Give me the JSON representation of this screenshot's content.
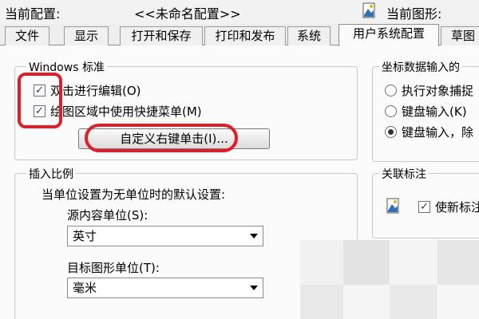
{
  "header": {
    "current_profile_label": "当前配置:",
    "current_profile_value": "<<未命名配置>>",
    "current_drawing_label": "当前图形:"
  },
  "tabs": [
    {
      "label": "文件"
    },
    {
      "label": "显示"
    },
    {
      "label": "打开和保存"
    },
    {
      "label": "打印和发布"
    },
    {
      "label": "系统"
    },
    {
      "label": "用户系统配置",
      "active": true
    },
    {
      "label": "草图"
    }
  ],
  "windows_standard": {
    "legend": "Windows 标准",
    "double_click_edit": {
      "label": "双击进行编辑(O)",
      "checked": true
    },
    "shortcut_menu": {
      "label": "绘图区域中使用快捷菜单(M)",
      "checked": true
    },
    "right_click_button": "自定义右键单击(I)..."
  },
  "insert_scale": {
    "legend": "插入比例",
    "description": "当单位设置为无单位时的默认设置:",
    "source_label": "源内容单位(S):",
    "source_value": "英寸",
    "target_label": "目标图形单位(T):",
    "target_value": "毫米"
  },
  "coord_input": {
    "legend": "坐标数据输入的",
    "options": [
      {
        "label": "执行对象捕捉",
        "selected": false
      },
      {
        "label": "键盘输入(K)",
        "selected": false
      },
      {
        "label": "键盘输入，除",
        "selected": true
      }
    ]
  },
  "associative_dim": {
    "legend": "关联标注",
    "checkbox_label": "使新标注",
    "checked": true
  },
  "colors": {
    "annotation_red": "#e11d2a",
    "check_blue": "#1e3a8a"
  }
}
